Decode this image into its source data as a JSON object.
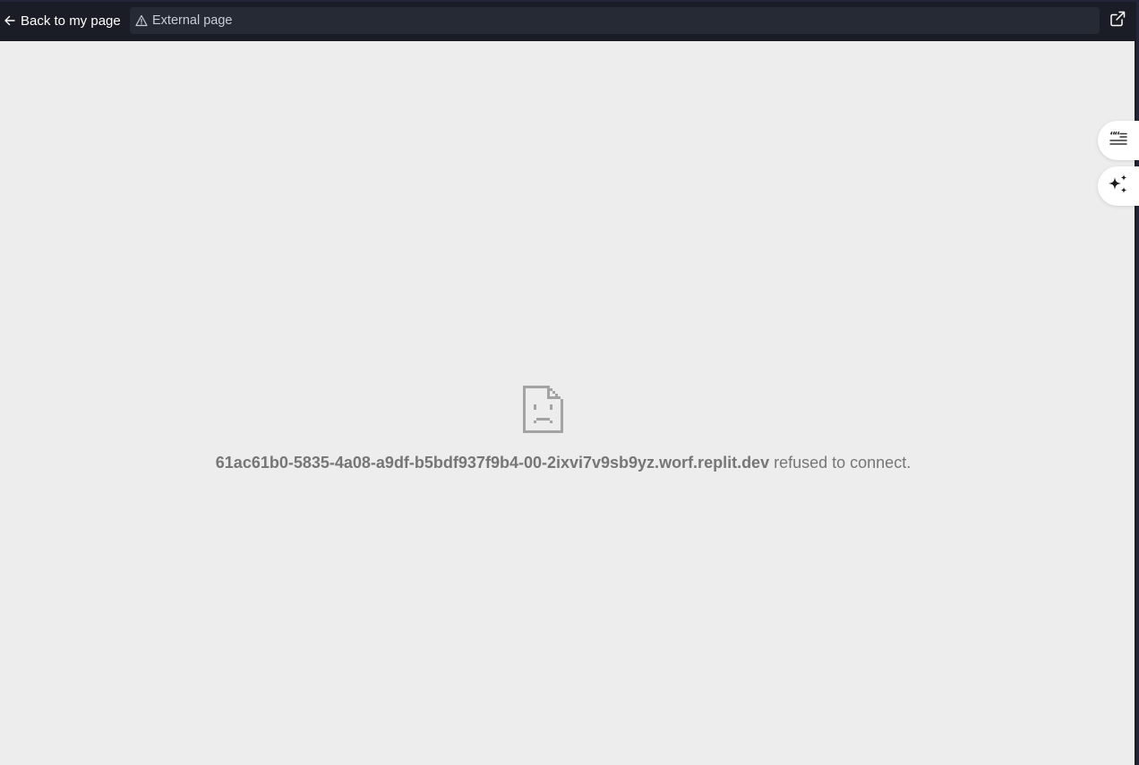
{
  "topbar": {
    "back_label": "Back to my page",
    "url_label": "External page",
    "icons": {
      "back": "arrow-left-icon",
      "warning": "warning-triangle-icon",
      "open_external": "external-link-icon"
    }
  },
  "side_actions": [
    {
      "name": "quote-button",
      "icon": "quote-list-icon"
    },
    {
      "name": "ai-assist-button",
      "icon": "sparkles-icon"
    }
  ],
  "error": {
    "icon": "sad-document-icon",
    "host": "61ac61b0-5835-4a08-a9df-b5bdf937f9b4-00-2ixvi7v9sb9yz.worf.replit.dev",
    "message": " refused to connect."
  },
  "colors": {
    "topbar_bg": "#1a1d26",
    "url_bar_bg": "#262a35",
    "page_bg": "#ededed",
    "error_text": "#767676"
  }
}
